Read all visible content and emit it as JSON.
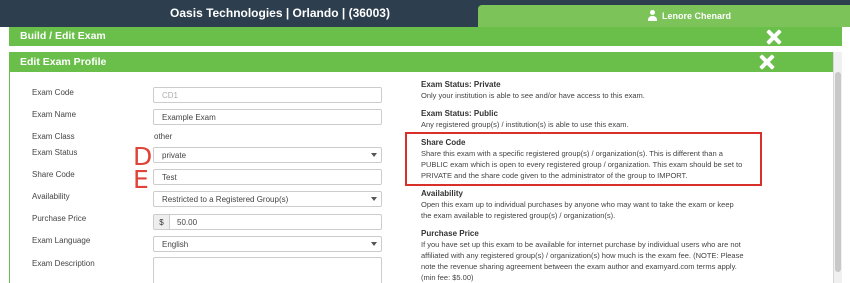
{
  "header": {
    "org": "Oasis Technologies | Orlando | (36003)",
    "user_name": "Lenore Chenard"
  },
  "panels": {
    "build_title": "Build / Edit Exam",
    "profile_title": "Edit Exam Profile"
  },
  "form": {
    "exam_code": {
      "label": "Exam Code",
      "placeholder": "CD1"
    },
    "exam_name": {
      "label": "Exam Name",
      "placeholder": "Example Exam"
    },
    "exam_class": {
      "label": "Exam Class",
      "value": "other"
    },
    "exam_status": {
      "label": "Exam Status",
      "value": "private"
    },
    "share_code": {
      "label": "Share Code",
      "value": "Test"
    },
    "availability": {
      "label": "Availability",
      "value": "Restricted to a Registered Group(s)"
    },
    "purchase_price": {
      "label": "Purchase Price",
      "currency": "$",
      "value": "50.00"
    },
    "exam_language": {
      "label": "Exam Language",
      "value": "English"
    },
    "exam_description": {
      "label": "Exam Description",
      "value": ""
    }
  },
  "annotations": {
    "d": "D",
    "e": "E"
  },
  "help": {
    "status_private_h": "Exam Status: Private",
    "status_private_t": "Only your institution is able to see and/or have access to this exam.",
    "status_public_h": "Exam Status: Public",
    "status_public_t": "Any registered group(s) / institution(s) is able to use this exam.",
    "share_code_h": "Share Code",
    "share_code_t": "Share this exam with a specific registered group(s) / organization(s). This is different than a PUBLIC exam which is open to every registered group / organization. This exam should be set to PRIVATE and the share code given to the administrator of the group to IMPORT.",
    "availability_h": "Availability",
    "availability_t": "Open this exam up to individual purchases by anyone who may want to take the exam or keep the exam available to registered group(s) / organization(s).",
    "purchase_price_h": "Purchase Price",
    "purchase_price_t": "If you have set up this exam to be available for internet purchase by individual users who are not affiliated with any registered group(s) / organization(s) how much is the exam fee. (NOTE: Please note the revenue sharing agreement between the exam author and examyard.com terms apply. (min fee: $5.00)"
  },
  "colors": {
    "header_bg": "#2d3e4e",
    "accent_green": "#6abf4b",
    "highlight_red": "#d9302c"
  }
}
